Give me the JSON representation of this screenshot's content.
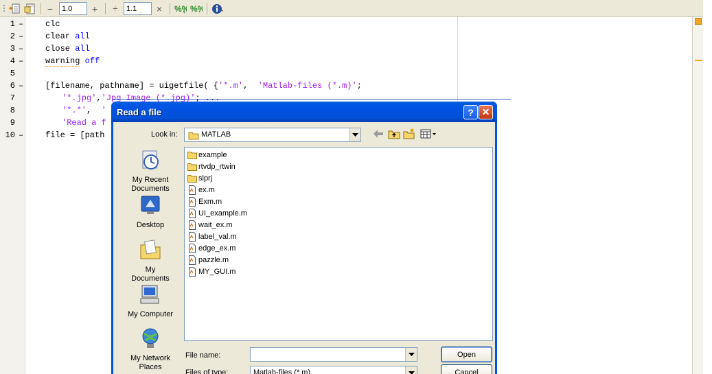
{
  "toolbar": {
    "cell_value_1": "1.0",
    "cell_value_2": "1.1",
    "minus_label": "−",
    "plus_label": "+",
    "divide_label": "÷",
    "times_label": "×"
  },
  "editor": {
    "lines": [
      {
        "num": "1",
        "dash": "–"
      },
      {
        "num": "2",
        "dash": "–"
      },
      {
        "num": "3",
        "dash": "–"
      },
      {
        "num": "4",
        "dash": "–"
      },
      {
        "num": "5",
        "dash": ""
      },
      {
        "num": "6",
        "dash": "–"
      },
      {
        "num": "7",
        "dash": ""
      },
      {
        "num": "8",
        "dash": ""
      },
      {
        "num": "9",
        "dash": ""
      },
      {
        "num": "10",
        "dash": "–"
      }
    ],
    "code": {
      "l1": "clc",
      "l2a": "clear ",
      "l2b": "all",
      "l3a": "close ",
      "l3b": "all",
      "l4a": "warning",
      "l4b": " off",
      "l6a": "[filename, pathname] = uigetfile( {",
      "l6b": "'*.m'",
      "l6c": ",  ",
      "l6d": "'Matlab-files (*.m)'",
      "l6e": ";",
      "l7a": "'*.jpg'",
      "l7b": ",",
      "l7c": "'Jpg Image (*.jpg)'",
      "l7d": "; ...",
      "l8a": "'*.*'",
      "l8b": ",  ",
      "l8c": "'",
      "l9a": "'Read a f",
      "l10a": "file = [path"
    }
  },
  "dialog": {
    "title": "Read a file",
    "help_label": "?",
    "close_label": "✕",
    "look_in_label": "Look in:",
    "look_in_value": "MATLAB",
    "places": [
      {
        "label": "My Recent Documents",
        "icon": "recent-documents-icon"
      },
      {
        "label": "Desktop",
        "icon": "desktop-icon"
      },
      {
        "label": "My Documents",
        "icon": "my-documents-icon"
      },
      {
        "label": "My Computer",
        "icon": "my-computer-icon"
      },
      {
        "label": "My Network Places",
        "icon": "network-places-icon"
      }
    ],
    "files": [
      {
        "name": "example",
        "type": "folder"
      },
      {
        "name": "rtvdp_rtwin",
        "type": "folder"
      },
      {
        "name": "slprj",
        "type": "folder"
      },
      {
        "name": "ex.m",
        "type": "file"
      },
      {
        "name": "Exm.m",
        "type": "file"
      },
      {
        "name": "UI_example.m",
        "type": "file"
      },
      {
        "name": "wait_ex.m",
        "type": "file"
      },
      {
        "name": "label_val.m",
        "type": "file"
      },
      {
        "name": "edge_ex.m",
        "type": "file"
      },
      {
        "name": "pazzle.m",
        "type": "file"
      },
      {
        "name": "MY_GUI.m",
        "type": "file"
      }
    ],
    "file_name_label": "File name:",
    "file_name_value": "",
    "files_of_type_label": "Files of type:",
    "files_of_type_value": "Matlab-files (*.m)",
    "open_label": "Open",
    "cancel_label": "Cancel"
  },
  "colors": {
    "keyword": "#0000ff",
    "string": "#a020f0",
    "title_bar": "#0054e3"
  }
}
